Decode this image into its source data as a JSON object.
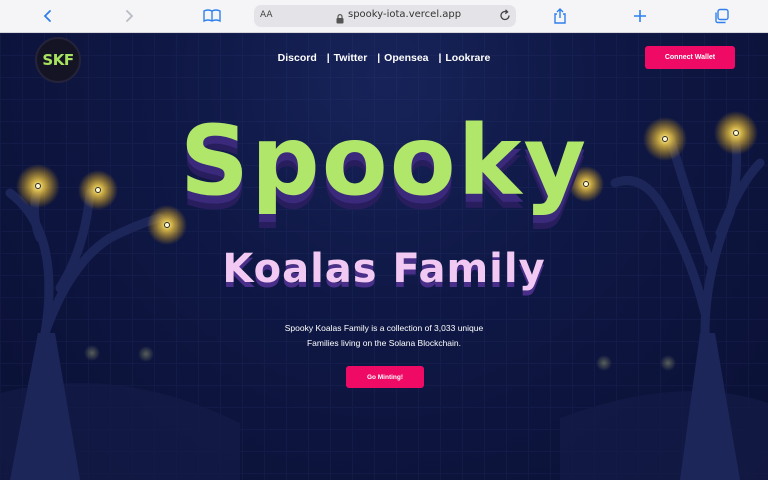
{
  "browser": {
    "aa_label": "AA",
    "url": "spooky-iota.vercel.app"
  },
  "site": {
    "logo_text": "SKF",
    "nav": [
      {
        "label": "Discord"
      },
      {
        "label": "Twitter"
      },
      {
        "label": "Opensea"
      },
      {
        "label": "Lookrare"
      }
    ],
    "nav_separator": "|",
    "connect_label": "Connect Wallet",
    "title": "Spooky",
    "subtitle": "Koalas Family",
    "description_line1": "Spooky Koalas Family is a collection of 3,033 unique",
    "description_line2": "Families living on the Solana Blockchain.",
    "mint_label": "Go Minting!"
  },
  "colors": {
    "background": "#0b1136",
    "accent": "#ef0b65",
    "title_green": "#b0e66a",
    "subtitle_pink": "#f2c9f2"
  },
  "icons": [
    "back-icon",
    "forward-icon",
    "book-icon",
    "lock-icon",
    "reload-icon",
    "share-icon",
    "plus-icon",
    "tabs-icon"
  ]
}
